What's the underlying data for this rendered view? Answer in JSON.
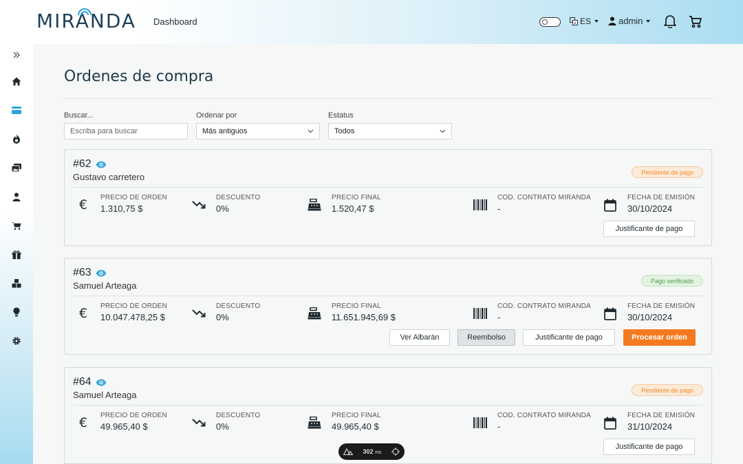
{
  "header": {
    "logo_text": "MIRANDA",
    "nav_label": "Dashboard",
    "language": "ES",
    "user": "admin",
    "icons": [
      "theme-toggle",
      "translate-icon",
      "user-icon",
      "bell-icon",
      "cart-icon"
    ]
  },
  "sidebar": {
    "items": [
      "expand-icon",
      "home-icon",
      "card-icon",
      "fire-icon",
      "images-icon",
      "user-icon",
      "cart-icon",
      "gift-icon",
      "boxes-icon",
      "lightbulb-icon",
      "gear-icon"
    ]
  },
  "page": {
    "title": "Ordenes de compra"
  },
  "filters": {
    "search_label": "Buscar...",
    "search_placeholder": "Escriba para buscar",
    "sort_label": "Ordenar por",
    "sort_value": "Más antiguos",
    "status_label": "Estatus",
    "status_value": "Todos"
  },
  "labels": {
    "order_price": "PRECIO DE ORDEN",
    "discount": "DESCUENTO",
    "final_price": "PRECIO FINAL",
    "contract_code": "COD. CONTRATO MIRANDA",
    "issue_date": "FECHA DE EMISIÓN"
  },
  "orders": [
    {
      "number": "#62",
      "customer": "Gustavo carretero",
      "status": "Pendiente de pago",
      "order_price": "1.310,75 $",
      "discount": "0%",
      "final_price": "1.520,47 $",
      "contract_code": "-",
      "issue_date": "30/10/2024",
      "buttons": [
        "Justificante de pago"
      ]
    },
    {
      "number": "#63",
      "customer": "Samuel Arteaga",
      "status": "Pago verificado",
      "order_price": "10.047.478,25 $",
      "discount": "0%",
      "final_price": "11.651.945,69 $",
      "contract_code": "-",
      "issue_date": "30/10/2024",
      "buttons": [
        "Ver Albarán",
        "Reembolso",
        "Justificante de pago",
        "Procesar orden"
      ]
    },
    {
      "number": "#64",
      "customer": "Samuel Arteaga",
      "status": "Pendiente de pago",
      "order_price": "49.965,40 $",
      "discount": "0%",
      "final_price": "49.965,40 $",
      "contract_code": "-",
      "issue_date": "31/10/2024",
      "buttons": [
        "Justificante de pago"
      ]
    }
  ],
  "devbar": {
    "time": "302",
    "unit": "ms"
  }
}
